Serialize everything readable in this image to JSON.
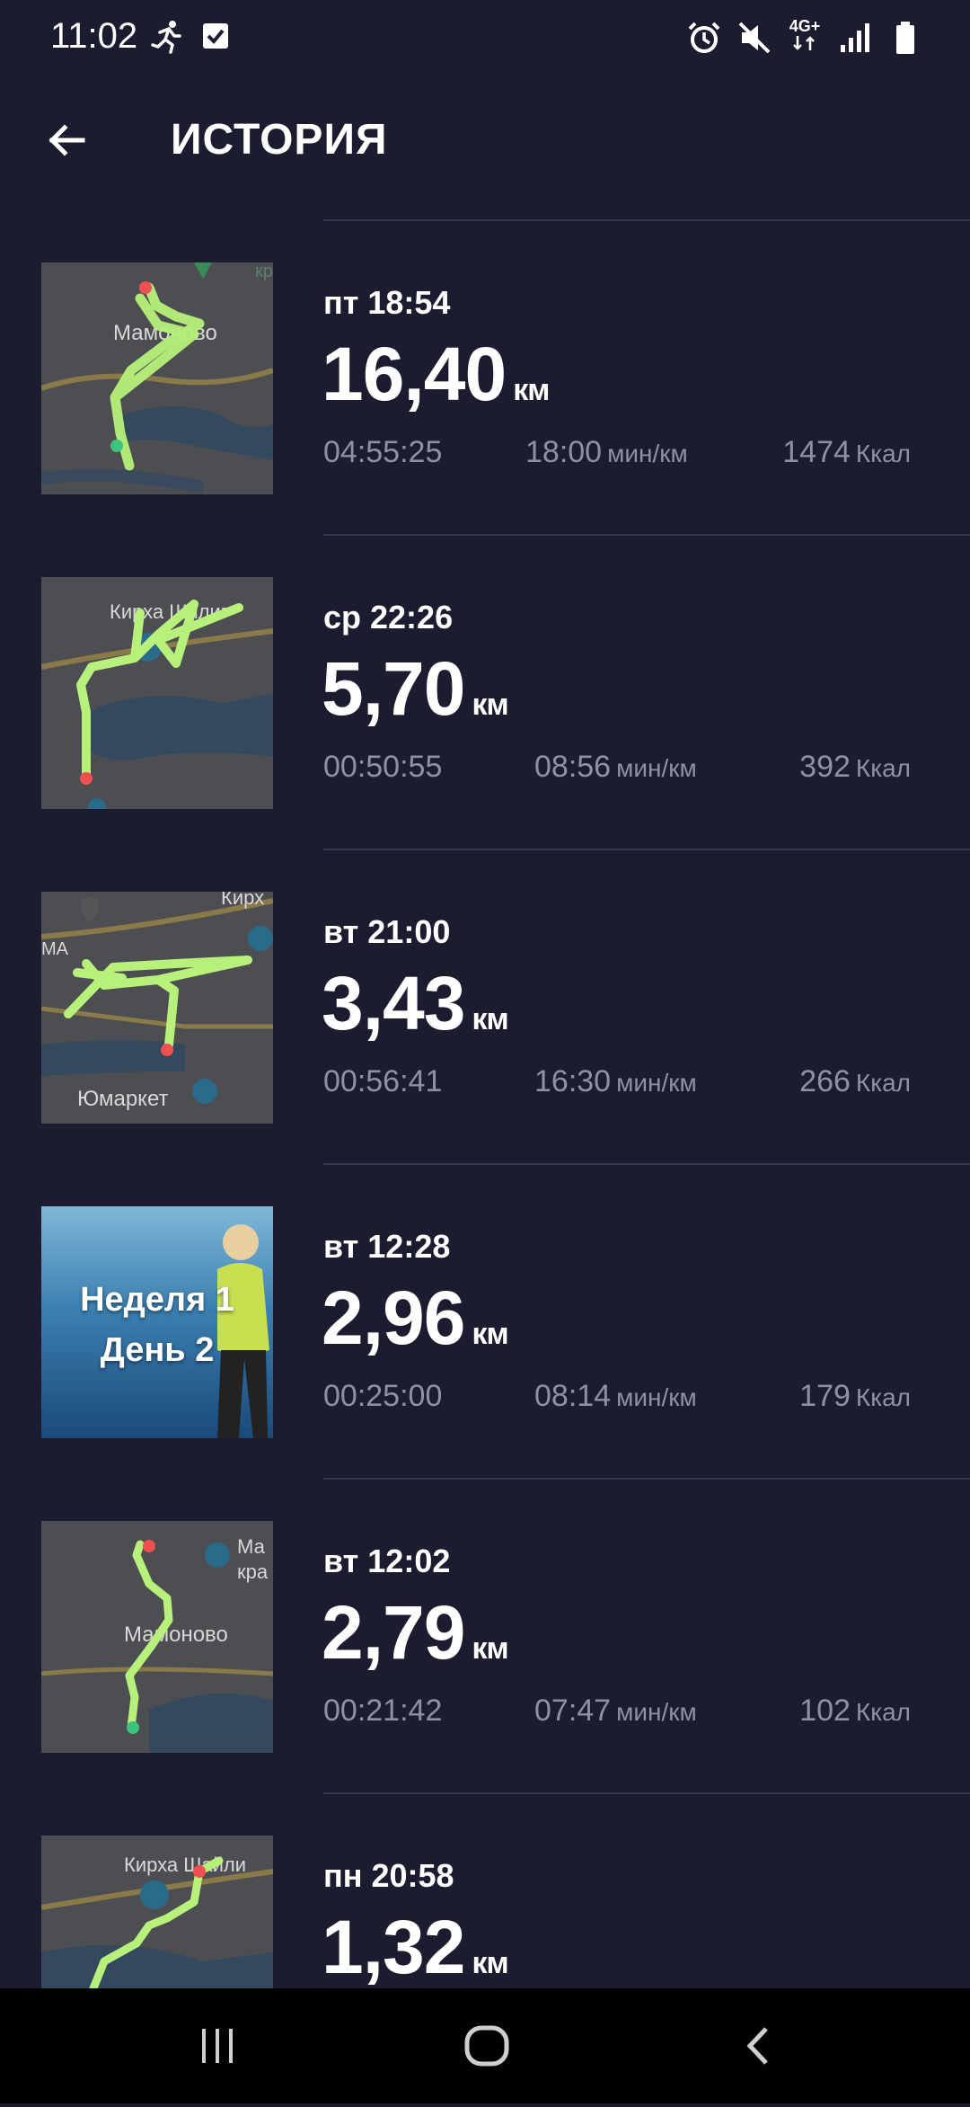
{
  "status_bar": {
    "time": "11:02",
    "network": "4G+",
    "icons": [
      "running-icon",
      "checkbox-icon",
      "alarm-icon",
      "mute-icon",
      "signal-icon",
      "battery-icon"
    ]
  },
  "header": {
    "title": "ИСТОРИЯ",
    "back_icon": "arrow-left-icon"
  },
  "colors": {
    "background": "#1c1c30",
    "divider": "#363852",
    "secondary_text": "#8f91a3",
    "track": "#b7f07a",
    "start_marker": "#3cc47c",
    "end_marker": "#f05050"
  },
  "history": [
    {
      "time": "пт 18:54",
      "distance": "16,40",
      "distance_unit": "км",
      "duration": "04:55:25",
      "pace": "18:00",
      "pace_unit": "мин/км",
      "calories": "1474",
      "calories_unit": "Ккал",
      "map_labels": [
        "Мамоново",
        "кра"
      ]
    },
    {
      "time": "ср 22:26",
      "distance": "5,70",
      "distance_unit": "км",
      "duration": "00:50:55",
      "pace": "08:56",
      "pace_unit": "мин/км",
      "calories": "392",
      "calories_unit": "Ккал",
      "map_labels": [
        "Кирха Шилиг"
      ]
    },
    {
      "time": "вт 21:00",
      "distance": "3,43",
      "distance_unit": "км",
      "duration": "00:56:41",
      "pace": "16:30",
      "pace_unit": "мин/км",
      "calories": "266",
      "calories_unit": "Ккал",
      "map_labels": [
        "Кирх",
        "МА",
        "Юмаркет"
      ]
    },
    {
      "time": "вт 12:28",
      "distance": "2,96",
      "distance_unit": "км",
      "duration": "00:25:00",
      "pace": "08:14",
      "pace_unit": "мин/км",
      "calories": "179",
      "calories_unit": "Ккал",
      "promo_line1": "Неделя 1",
      "promo_line2": "День 2"
    },
    {
      "time": "вт 12:02",
      "distance": "2,79",
      "distance_unit": "км",
      "duration": "00:21:42",
      "pace": "07:47",
      "pace_unit": "мин/км",
      "calories": "102",
      "calories_unit": "Ккал",
      "map_labels": [
        "Мамоново",
        "Ма",
        "кра"
      ]
    },
    {
      "time": "пн 20:58",
      "distance": "1,32",
      "distance_unit": "км",
      "map_labels": [
        "Кирха Шайли"
      ]
    }
  ],
  "nav_bar": {
    "icons": [
      "recent-apps-icon",
      "home-icon",
      "back-icon"
    ]
  }
}
